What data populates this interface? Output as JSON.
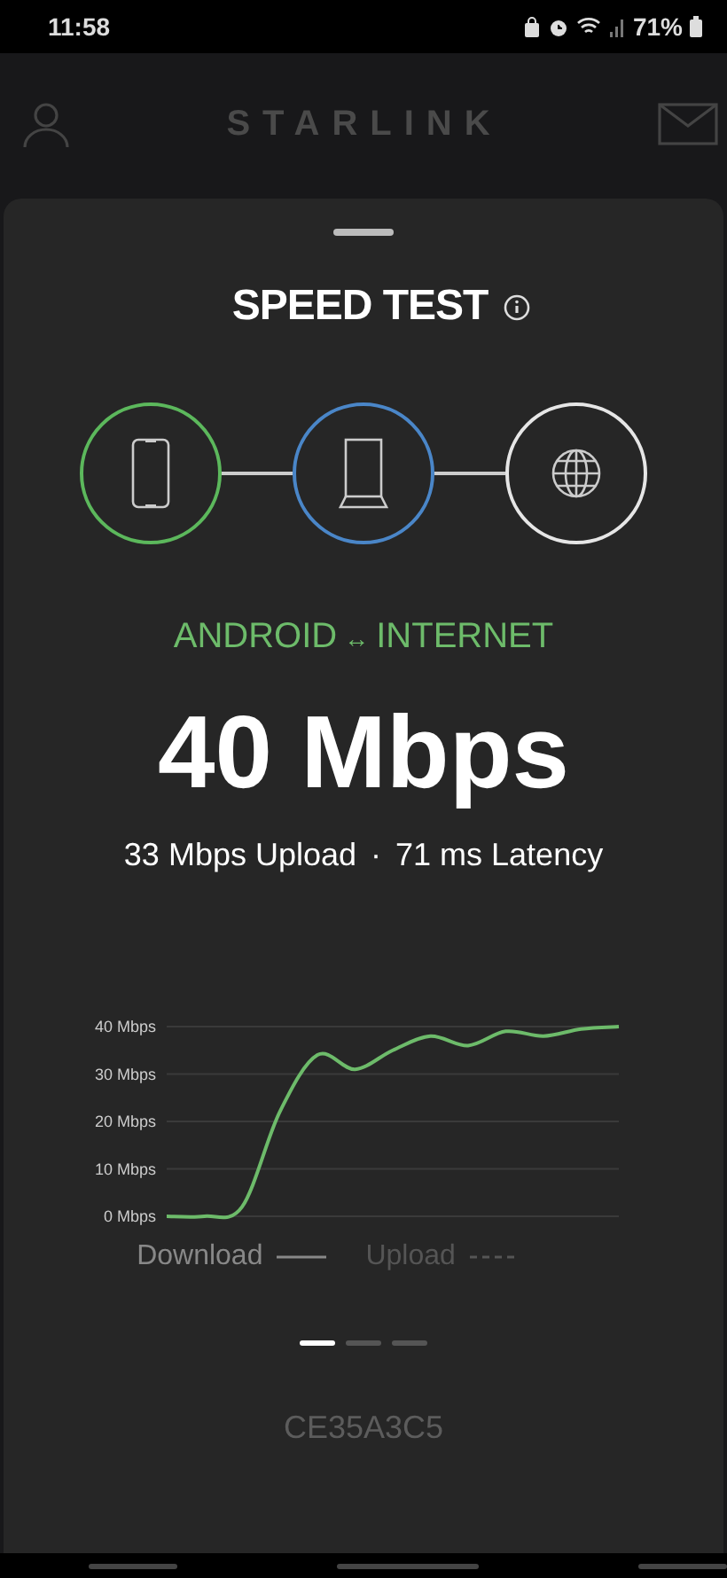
{
  "status_bar": {
    "time": "11:58",
    "battery": "71%"
  },
  "header": {
    "title": "STARLINK"
  },
  "sheet": {
    "title": "SPEED TEST",
    "nodes": [
      {
        "kind": "phone",
        "color": "#5cb85c"
      },
      {
        "kind": "router",
        "color": "#4a86c8"
      },
      {
        "kind": "globe",
        "color": "#e6e6e6"
      }
    ],
    "route": {
      "from": "ANDROID",
      "arrow": "↔",
      "to": "INTERNET"
    },
    "speed": "40 Mbps",
    "upload": "33 Mbps Upload",
    "separator": "·",
    "latency": "71 ms Latency",
    "chart_data": {
      "type": "line",
      "grid": true,
      "ylim": [
        0,
        40
      ],
      "yticks": [
        {
          "value": 0,
          "label": "0 Mbps"
        },
        {
          "value": 10,
          "label": "10 Mbps"
        },
        {
          "value": 20,
          "label": "20 Mbps"
        },
        {
          "value": 30,
          "label": "30 Mbps"
        },
        {
          "value": 40,
          "label": "40 Mbps"
        }
      ],
      "series": [
        {
          "name": "Download",
          "color": "#6dbb6a",
          "values": [
            0,
            0,
            2,
            22,
            34,
            31,
            35,
            38,
            36,
            39,
            38,
            39.5,
            40
          ]
        }
      ]
    },
    "legend": [
      {
        "label": "Upload",
        "active": false,
        "kind": "dashed"
      }
    ],
    "pages": [
      {
        "selected": true
      },
      {
        "selected": false
      },
      {
        "selected": false
      }
    ],
    "device_id": "CE35A3C5"
  }
}
